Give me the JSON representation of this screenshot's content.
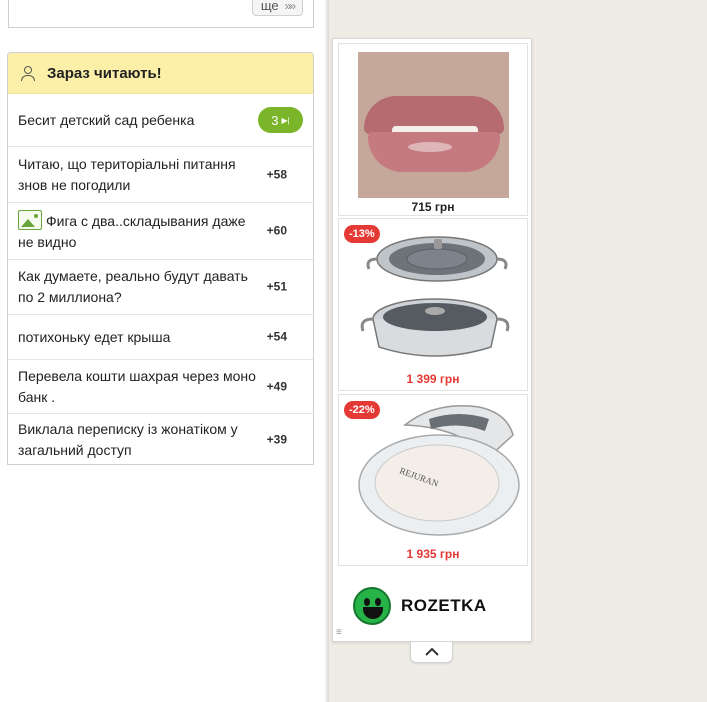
{
  "top": {
    "more_label": "ще"
  },
  "reading_now": {
    "title": "Зараз читають!",
    "items": [
      {
        "text": "Бесит детский сад ребенка",
        "count": "3"
      },
      {
        "text": "Читаю, що територіальні питання знов не погодили",
        "count": "+58"
      },
      {
        "text": "Фига с два..складывания даже не видно",
        "count": "+60"
      },
      {
        "text": "Как думаете, реально будут давать по 2 миллиона?",
        "count": "+51"
      },
      {
        "text": "потихоньку едет крыша",
        "count": "+54"
      },
      {
        "text": "Перевела кошти шахрая через моно банк .",
        "count": "+49"
      },
      {
        "text": "Виклала переписку із жонатіком у загальний доступ",
        "count": "+39"
      }
    ]
  },
  "ad": {
    "products": [
      {
        "price": "715 грн",
        "discount": ""
      },
      {
        "price": "1 399 грн",
        "discount": "-13%"
      },
      {
        "price": "1 935 грн",
        "discount": "-22%"
      }
    ],
    "product_images": {
      "compact_brand": "REJURAN"
    },
    "brand": "ROZETKA"
  },
  "colors": {
    "header_bg": "#fcf0a8",
    "accent_green": "#7ab52a",
    "price_red": "#e53935",
    "rozetka_green": "#28b348"
  }
}
